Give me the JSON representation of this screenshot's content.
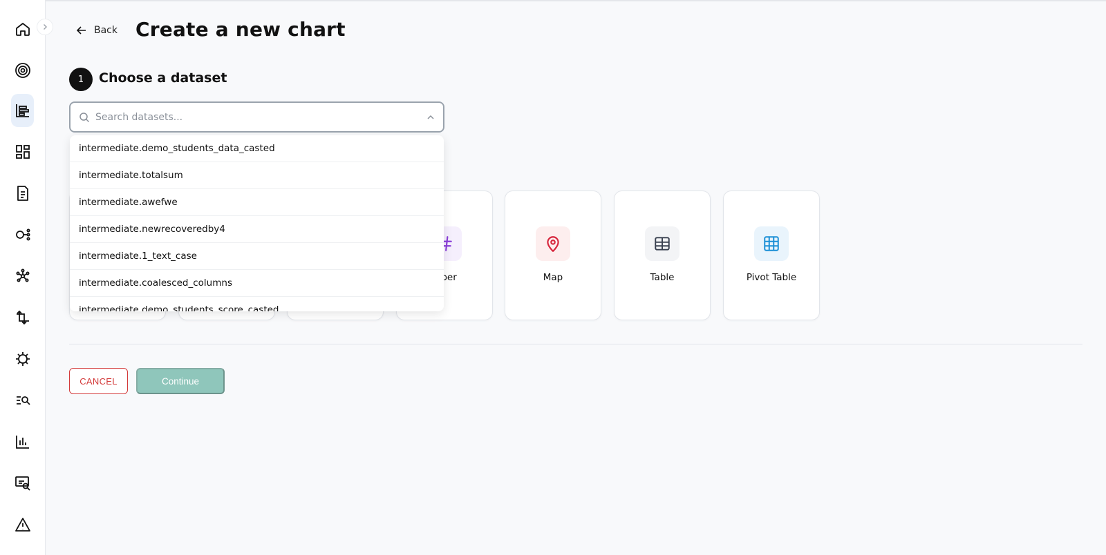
{
  "nav": {
    "items": [
      {
        "icon": "home-icon"
      },
      {
        "icon": "target-icon"
      },
      {
        "icon": "charts-icon",
        "active": true
      },
      {
        "icon": "dashboards-icon"
      },
      {
        "icon": "document-icon"
      },
      {
        "icon": "pipeline-icon"
      },
      {
        "icon": "network-icon"
      },
      {
        "icon": "transform-icon"
      },
      {
        "icon": "virus-icon"
      },
      {
        "icon": "search-list-icon"
      },
      {
        "icon": "bar-chart-icon"
      },
      {
        "icon": "monitor-search-icon"
      },
      {
        "icon": "warning-icon"
      }
    ]
  },
  "header": {
    "back_label": "Back",
    "title": "Create a new chart"
  },
  "step": {
    "number": "1",
    "title": "Choose a dataset"
  },
  "search": {
    "placeholder": "Search datasets...",
    "value": ""
  },
  "dropdown": {
    "items": [
      "intermediate.demo_students_data_casted",
      "intermediate.totalsum",
      "intermediate.awefwe",
      "intermediate.newrecoveredby4",
      "intermediate.1_text_case",
      "intermediate.coalesced_columns",
      "intermediate.demo_students_score_casted"
    ]
  },
  "chart_types": {
    "number_partial": "mber",
    "map": "Map",
    "table": "Table",
    "pivot": "Pivot Table"
  },
  "colors": {
    "map_icon": "#d7263d",
    "number_icon": "#8b3fd9",
    "pivot_icon": "#1a8fd6",
    "continue_bg": "#8fc6bb",
    "cancel": "#d33a3a"
  },
  "actions": {
    "cancel_label": "CANCEL",
    "continue_label": "Continue"
  }
}
